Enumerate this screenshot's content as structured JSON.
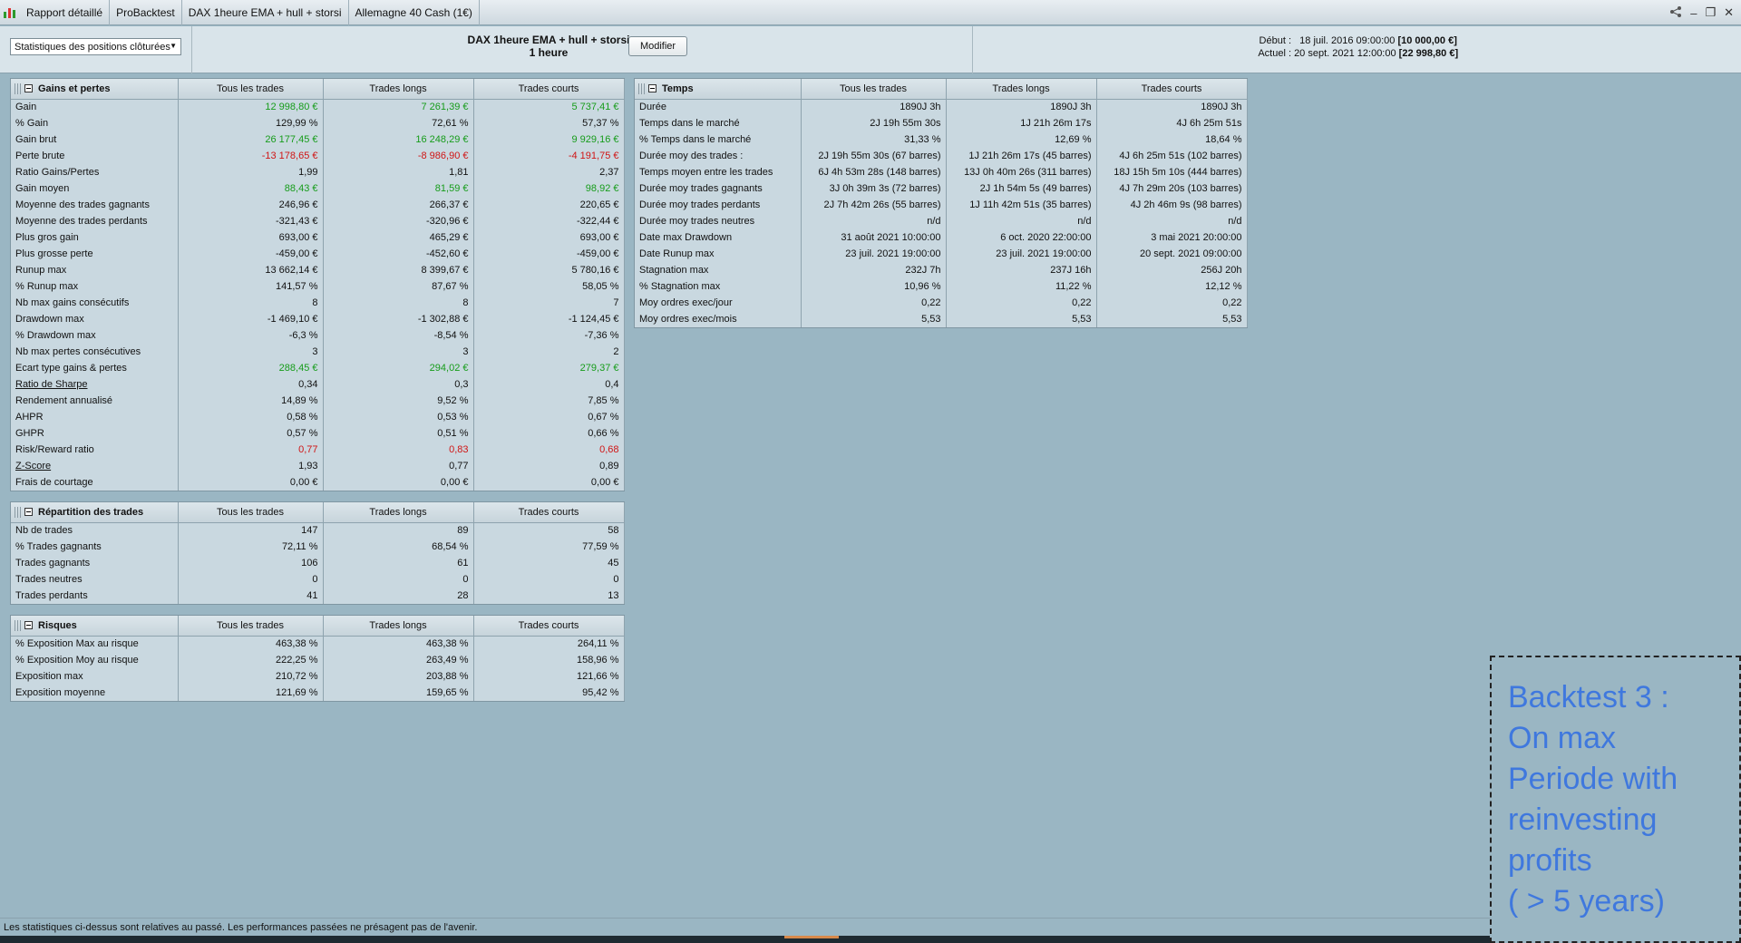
{
  "titlebar": {
    "crumbs": [
      "Rapport détaillé",
      "ProBacktest",
      "DAX 1heure EMA + hull + storsi",
      "Allemagne 40 Cash (1€)"
    ]
  },
  "header": {
    "select_value": "Statistiques des positions clôturées",
    "strategy_name": "DAX 1heure EMA + hull + storsi",
    "timeframe": "1 heure",
    "modify_label": "Modifier",
    "start_label": "Début :",
    "start_value": "18 juil. 2016 09:00:00",
    "start_capital": "[10 000,00 €]",
    "current_label": "Actuel :",
    "current_value": "20 sept. 2021 12:00:00",
    "current_capital": "[22 998,80 €]"
  },
  "gains": {
    "title": "Gains et pertes",
    "cols": [
      "Tous les trades",
      "Trades longs",
      "Trades courts"
    ],
    "rows": [
      {
        "label": "Gain",
        "vals": [
          "12 998,80 €",
          "7 261,39 €",
          "5 737,41 €"
        ],
        "cls": "pos"
      },
      {
        "label": "% Gain",
        "vals": [
          "129,99 %",
          "72,61 %",
          "57,37 %"
        ],
        "cls": ""
      },
      {
        "label": "Gain brut",
        "vals": [
          "26 177,45 €",
          "16 248,29 €",
          "9 929,16 €"
        ],
        "cls": "pos"
      },
      {
        "label": "Perte brute",
        "vals": [
          "-13 178,65 €",
          "-8 986,90 €",
          "-4 191,75 €"
        ],
        "cls": "neg"
      },
      {
        "label": "Ratio Gains/Pertes",
        "vals": [
          "1,99",
          "1,81",
          "2,37"
        ],
        "cls": ""
      },
      {
        "label": "Gain moyen",
        "vals": [
          "88,43 €",
          "81,59 €",
          "98,92 €"
        ],
        "cls": "pos"
      },
      {
        "label": "Moyenne des trades gagnants",
        "vals": [
          "246,96 €",
          "266,37 €",
          "220,65 €"
        ],
        "cls": ""
      },
      {
        "label": "Moyenne des trades perdants",
        "vals": [
          "-321,43 €",
          "-320,96 €",
          "-322,44 €"
        ],
        "cls": ""
      },
      {
        "label": "Plus gros gain",
        "vals": [
          "693,00 €",
          "465,29 €",
          "693,00 €"
        ],
        "cls": ""
      },
      {
        "label": "Plus grosse perte",
        "vals": [
          "-459,00 €",
          "-452,60 €",
          "-459,00 €"
        ],
        "cls": ""
      },
      {
        "label": "Runup max",
        "vals": [
          "13 662,14 €",
          "8 399,67 €",
          "5 780,16 €"
        ],
        "cls": ""
      },
      {
        "label": "% Runup max",
        "vals": [
          "141,57 %",
          "87,67 %",
          "58,05 %"
        ],
        "cls": ""
      },
      {
        "label": "Nb max gains consécutifs",
        "vals": [
          "8",
          "8",
          "7"
        ],
        "cls": ""
      },
      {
        "label": "Drawdown max",
        "vals": [
          "-1 469,10 €",
          "-1 302,88 €",
          "-1 124,45 €"
        ],
        "cls": ""
      },
      {
        "label": "% Drawdown max",
        "vals": [
          "-6,3 %",
          "-8,54 %",
          "-7,36 %"
        ],
        "cls": ""
      },
      {
        "label": "Nb max pertes consécutives",
        "vals": [
          "3",
          "3",
          "2"
        ],
        "cls": ""
      },
      {
        "label": "Ecart type gains & pertes",
        "vals": [
          "288,45 €",
          "294,02 €",
          "279,37 €"
        ],
        "cls": "pos"
      },
      {
        "label": "Ratio de Sharpe",
        "vals": [
          "0,34",
          "0,3",
          "0,4"
        ],
        "cls": "",
        "ul": true
      },
      {
        "label": "Rendement annualisé",
        "vals": [
          "14,89 %",
          "9,52 %",
          "7,85 %"
        ],
        "cls": ""
      },
      {
        "label": "AHPR",
        "vals": [
          "0,58 %",
          "0,53 %",
          "0,67 %"
        ],
        "cls": ""
      },
      {
        "label": "GHPR",
        "vals": [
          "0,57 %",
          "0,51 %",
          "0,66 %"
        ],
        "cls": ""
      },
      {
        "label": "Risk/Reward ratio",
        "vals": [
          "0,77",
          "0,83",
          "0,68"
        ],
        "cls": "neg"
      },
      {
        "label": "Z-Score",
        "vals": [
          "1,93",
          "0,77",
          "0,89"
        ],
        "cls": "",
        "ul": true
      },
      {
        "label": "Frais de courtage",
        "vals": [
          "0,00 €",
          "0,00 €",
          "0,00 €"
        ],
        "cls": ""
      }
    ]
  },
  "repartition": {
    "title": "Répartition des trades",
    "cols": [
      "Tous les trades",
      "Trades longs",
      "Trades courts"
    ],
    "rows": [
      {
        "label": "Nb de trades",
        "vals": [
          "147",
          "89",
          "58"
        ],
        "cls": ""
      },
      {
        "label": "% Trades gagnants",
        "vals": [
          "72,11 %",
          "68,54 %",
          "77,59 %"
        ],
        "cls": ""
      },
      {
        "label": "Trades gagnants",
        "vals": [
          "106",
          "61",
          "45"
        ],
        "cls": ""
      },
      {
        "label": "Trades neutres",
        "vals": [
          "0",
          "0",
          "0"
        ],
        "cls": ""
      },
      {
        "label": "Trades perdants",
        "vals": [
          "41",
          "28",
          "13"
        ],
        "cls": ""
      }
    ]
  },
  "risques": {
    "title": "Risques",
    "cols": [
      "Tous les trades",
      "Trades longs",
      "Trades courts"
    ],
    "rows": [
      {
        "label": "% Exposition Max au risque",
        "vals": [
          "463,38 %",
          "463,38 %",
          "264,11 %"
        ],
        "cls": ""
      },
      {
        "label": "% Exposition Moy au risque",
        "vals": [
          "222,25 %",
          "263,49 %",
          "158,96 %"
        ],
        "cls": ""
      },
      {
        "label": "Exposition max",
        "vals": [
          "210,72 %",
          "203,88 %",
          "121,66 %"
        ],
        "cls": ""
      },
      {
        "label": "Exposition moyenne",
        "vals": [
          "121,69 %",
          "159,65 %",
          "95,42 %"
        ],
        "cls": ""
      }
    ]
  },
  "temps": {
    "title": "Temps",
    "cols": [
      "Tous les trades",
      "Trades longs",
      "Trades courts"
    ],
    "rows": [
      {
        "label": "Durée",
        "vals": [
          "1890J 3h",
          "1890J 3h",
          "1890J 3h"
        ],
        "cls": ""
      },
      {
        "label": "Temps dans le marché",
        "vals": [
          "2J 19h 55m 30s",
          "1J 21h 26m 17s",
          "4J 6h 25m 51s"
        ],
        "cls": ""
      },
      {
        "label": "% Temps dans le marché",
        "vals": [
          "31,33 %",
          "12,69 %",
          "18,64 %"
        ],
        "cls": ""
      },
      {
        "label": "Durée moy des trades :",
        "vals": [
          "2J 19h 55m 30s (67 barres)",
          "1J 21h 26m 17s (45 barres)",
          "4J 6h 25m 51s (102 barres)"
        ],
        "cls": ""
      },
      {
        "label": "Temps moyen entre les trades",
        "vals": [
          "6J 4h 53m 28s (148 barres)",
          "13J 0h 40m 26s (311 barres)",
          "18J 15h 5m 10s (444 barres)"
        ],
        "cls": ""
      },
      {
        "label": "Durée moy trades gagnants",
        "vals": [
          "3J 0h 39m 3s (72 barres)",
          "2J 1h 54m 5s (49 barres)",
          "4J 7h 29m 20s (103 barres)"
        ],
        "cls": ""
      },
      {
        "label": "Durée moy trades perdants",
        "vals": [
          "2J 7h 42m 26s (55 barres)",
          "1J 11h 42m 51s (35 barres)",
          "4J 2h 46m 9s (98 barres)"
        ],
        "cls": ""
      },
      {
        "label": "Durée moy trades neutres",
        "vals": [
          "n/d",
          "n/d",
          "n/d"
        ],
        "cls": ""
      },
      {
        "label": "Date max Drawdown",
        "vals": [
          "31 août 2021 10:00:00",
          "6 oct. 2020 22:00:00",
          "3 mai 2021 20:00:00"
        ],
        "cls": ""
      },
      {
        "label": "Date Runup max",
        "vals": [
          "23 juil. 2021 19:00:00",
          "23 juil. 2021 19:00:00",
          "20 sept. 2021 09:00:00"
        ],
        "cls": ""
      },
      {
        "label": "Stagnation max",
        "vals": [
          "232J 7h",
          "237J 16h",
          "256J 20h"
        ],
        "cls": ""
      },
      {
        "label": "% Stagnation max",
        "vals": [
          "10,96 %",
          "11,22 %",
          "12,12 %"
        ],
        "cls": ""
      },
      {
        "label": "Moy ordres exec/jour",
        "vals": [
          "0,22",
          "0,22",
          "0,22"
        ],
        "cls": ""
      },
      {
        "label": "Moy ordres exec/mois",
        "vals": [
          "5,53",
          "5,53",
          "5,53"
        ],
        "cls": ""
      }
    ]
  },
  "note": {
    "lines": [
      "Backtest 3 :",
      "On max",
      "Periode with",
      "reinvesting",
      "profits",
      "( > 5 years)"
    ]
  },
  "footer": {
    "disclaimer": "Les statistiques ci-dessus sont relatives au passé. Les performances passées ne présagent pas de l'avenir."
  },
  "colors": {
    "positive": "#169c1a",
    "negative": "#d01515",
    "note_text": "#3f78de"
  }
}
